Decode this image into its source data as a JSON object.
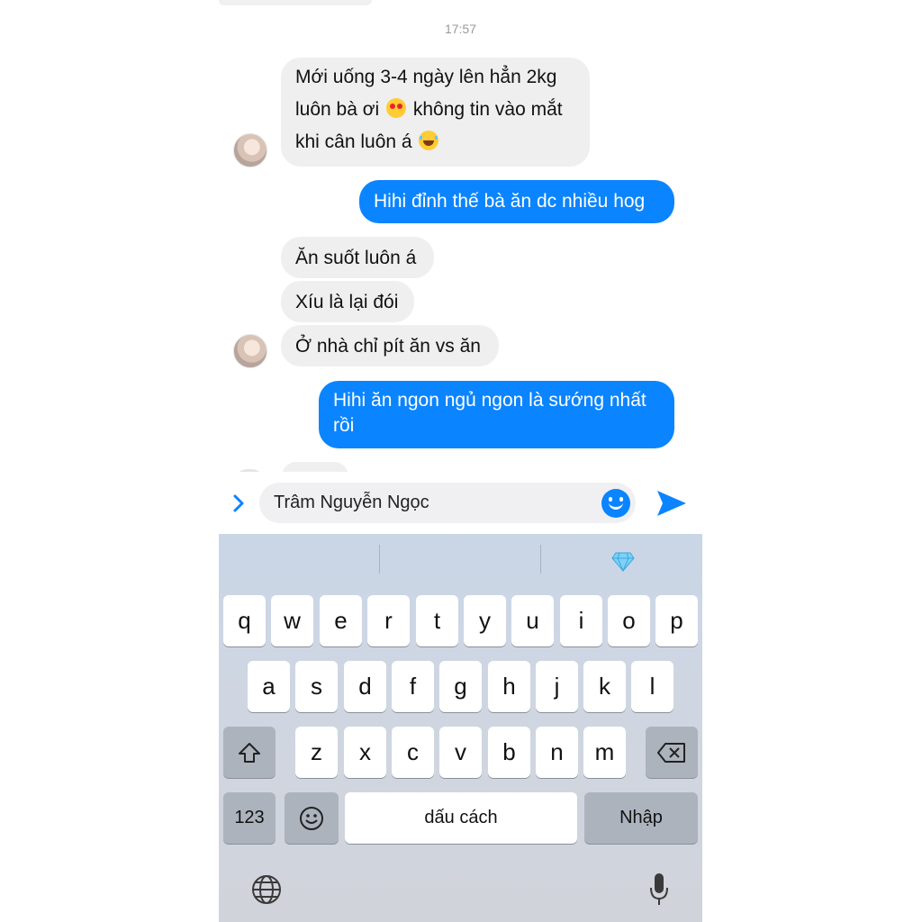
{
  "chat": {
    "timestamp": "17:57",
    "messages": [
      {
        "from": "them",
        "lines": [
          "Mới uống 3-4 ngày lên hẳn 2kg",
          "luôn bà ơi",
          "không tin vào mắt",
          "khi cân luôn á"
        ]
      },
      {
        "from": "me",
        "text": "Hihi đỉnh thế bà ăn dc nhiều hog"
      },
      {
        "from": "them",
        "text": "Ăn suốt luôn á"
      },
      {
        "from": "them",
        "text": "Xíu là lại đói"
      },
      {
        "from": "them",
        "text": "Ở nhà chỉ pít ăn vs ăn"
      },
      {
        "from": "me",
        "lines": [
          "Hihi ăn ngon ngủ ngon là sướng nhất",
          "rồi"
        ]
      }
    ]
  },
  "composer": {
    "value": "Trâm Nguyễn Ngọc",
    "expand_icon": "chevron-right-icon",
    "emoji_icon": "smiley-icon",
    "send_icon": "send-icon",
    "accent_color": "#0b84ff"
  },
  "keyboard": {
    "row1": [
      "q",
      "w",
      "e",
      "r",
      "t",
      "y",
      "u",
      "i",
      "o",
      "p"
    ],
    "row2": [
      "a",
      "s",
      "d",
      "f",
      "g",
      "h",
      "j",
      "k",
      "l"
    ],
    "row3": [
      "z",
      "x",
      "c",
      "v",
      "b",
      "n",
      "m"
    ],
    "numbers_label": "123",
    "space_label": "dấu cách",
    "return_label": "Nhập",
    "prediction_icon": "gem-icon",
    "shift_icon": "shift-icon",
    "delete_icon": "backspace-icon",
    "emoji_icon": "emoji-icon",
    "globe_icon": "globe-icon",
    "mic_icon": "microphone-icon"
  }
}
